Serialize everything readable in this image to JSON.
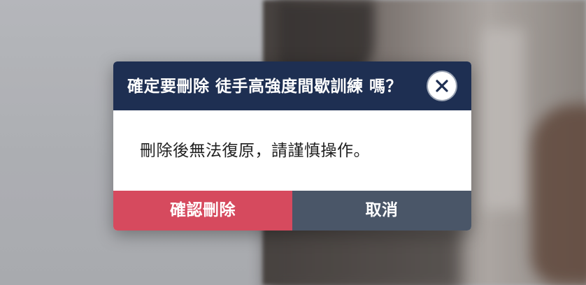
{
  "dialog": {
    "title": "確定要刪除 徒手高強度間歇訓練 嗎？",
    "close_icon": "close-icon",
    "message": "刪除後無法復原，請謹慎操作。",
    "confirm_label": "確認刪除",
    "cancel_label": "取消"
  },
  "colors": {
    "header_bg": "#1e2f52",
    "confirm_bg": "#d64a5e",
    "cancel_bg": "#4a5668"
  }
}
